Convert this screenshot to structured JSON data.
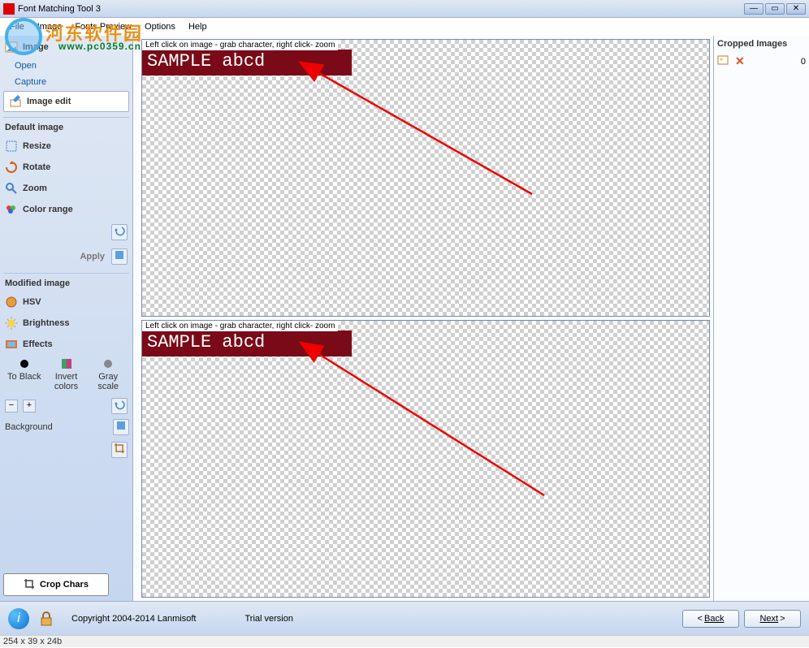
{
  "window": {
    "title": "Font Matching Tool 3"
  },
  "watermark": {
    "cn": "河东软件园",
    "url": "www.pc0359.cn"
  },
  "menu": {
    "file": "File",
    "image": "Image",
    "fonts_preview": "Fonts Preview",
    "options": "Options",
    "help": "Help"
  },
  "sidebar": {
    "image_header": "Image",
    "open": "Open",
    "capture": "Capture",
    "image_edit": "Image edit",
    "default_image": "Default image",
    "resize": "Resize",
    "rotate": "Rotate",
    "zoom": "Zoom",
    "color_range": "Color range",
    "apply": "Apply",
    "modified_image": "Modified image",
    "hsv": "HSV",
    "brightness": "Brightness",
    "effects": "Effects",
    "to_black": "To Black",
    "invert_colors": "Invert colors",
    "gray_scale": "Gray scale",
    "background": "Background",
    "crop_chars": "Crop Chars"
  },
  "canvas": {
    "hint": "Left click on image - grab character, right click- zoom",
    "sample_text": "SAMPLE abcd"
  },
  "right_panel": {
    "header": "Cropped Images",
    "count": "0"
  },
  "footer": {
    "copyright": "Copyright 2004-2014 Lanmisoft",
    "trial": "Trial version",
    "back": "Back",
    "next": "Next"
  },
  "status": {
    "dims": "254 x 39 x 24b"
  }
}
